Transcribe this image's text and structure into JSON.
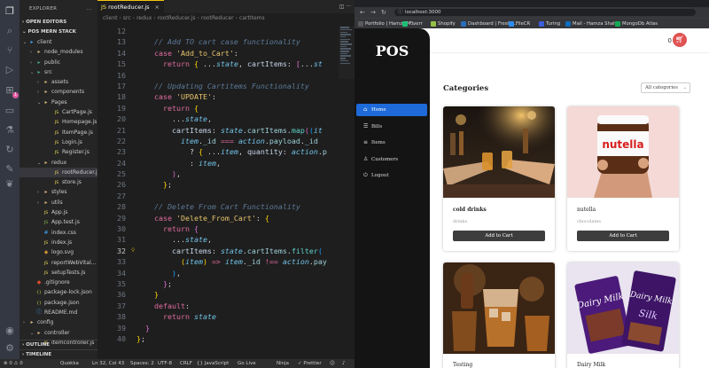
{
  "vscode": {
    "explorer_title": "EXPLORER",
    "explorer_more": "...",
    "open_editors": "OPEN EDITORS",
    "project": "POS MERN STACK",
    "tree": [
      {
        "label": "client",
        "kind": "folder-blue",
        "chev": "⌄"
      },
      {
        "label": "node_modules",
        "kind": "folder",
        "chev": "›"
      },
      {
        "label": "public",
        "kind": "folder-pub",
        "chev": "›"
      },
      {
        "label": "src",
        "kind": "folder-src",
        "chev": "⌄"
      },
      {
        "label": "assets",
        "kind": "folder",
        "chev": "›"
      },
      {
        "label": "components",
        "kind": "folder",
        "chev": "›"
      },
      {
        "label": "Pages",
        "kind": "folder",
        "chev": "⌄"
      },
      {
        "label": "CartPage.js",
        "kind": "js",
        "chev": ""
      },
      {
        "label": "Homepage.js",
        "kind": "js",
        "chev": ""
      },
      {
        "label": "ItemPage.js",
        "kind": "js",
        "chev": ""
      },
      {
        "label": "Login.js",
        "kind": "js",
        "chev": ""
      },
      {
        "label": "Register.js",
        "kind": "js",
        "chev": ""
      },
      {
        "label": "redux",
        "kind": "folder",
        "chev": "⌄"
      },
      {
        "label": "rootReducer.js",
        "kind": "js",
        "chev": "",
        "selected": true
      },
      {
        "label": "store.js",
        "kind": "js",
        "chev": ""
      },
      {
        "label": "styles",
        "kind": "folder",
        "chev": "›"
      },
      {
        "label": "utils",
        "kind": "folder",
        "chev": "›"
      },
      {
        "label": "App.js",
        "kind": "js",
        "chev": ""
      },
      {
        "label": "App.test.js",
        "kind": "test",
        "chev": ""
      },
      {
        "label": "index.css",
        "kind": "css",
        "chev": ""
      },
      {
        "label": "index.js",
        "kind": "js",
        "chev": ""
      },
      {
        "label": "logo.svg",
        "kind": "svg",
        "chev": ""
      },
      {
        "label": "reportWebVital...",
        "kind": "js",
        "chev": ""
      },
      {
        "label": "setupTests.js",
        "kind": "js",
        "chev": ""
      },
      {
        "label": ".gitignore",
        "kind": "git",
        "chev": ""
      },
      {
        "label": "package-lock.json",
        "kind": "json",
        "chev": ""
      },
      {
        "label": "package.json",
        "kind": "json",
        "chev": ""
      },
      {
        "label": "README.md",
        "kind": "md",
        "chev": ""
      },
      {
        "label": "config",
        "kind": "folder",
        "chev": "›"
      },
      {
        "label": "controller",
        "kind": "folder",
        "chev": "⌄"
      },
      {
        "label": "itemcontroller.js",
        "kind": "js",
        "chev": ""
      }
    ],
    "outline": "OUTLINE",
    "timeline": "TIMELINE",
    "tab_label": "rootReducer.js",
    "breadcrumb": [
      "client",
      "src",
      "redux",
      "rootReducer.js",
      "rootReducer",
      "cartItems"
    ],
    "code_lines": [
      {
        "n": "12",
        "html": ""
      },
      {
        "n": "13",
        "html": "    <span class='c'>// Add TO cart case functionality</span>"
      },
      {
        "n": "14",
        "html": "    <span class='k'>case</span> <span class='s'>'Add_to_Cart'</span><span class='p'>:</span>"
      },
      {
        "n": "15",
        "html": "      <span class='k'>return</span> <span class='br1'>{</span> <span class='p'>...</span><span class='it'>state</span><span class='p'>,</span> <span class='v'>cartItems</span><span class='p'>:</span> <span class='br2'>[</span><span class='p'>...</span><span class='it'>st</span>"
      },
      {
        "n": "16",
        "html": ""
      },
      {
        "n": "17",
        "html": "    <span class='c'>// Updating Cartitems Functionality</span>"
      },
      {
        "n": "18",
        "html": "    <span class='k'>case</span> <span class='s'>'UPDATE'</span><span class='p'>:</span>"
      },
      {
        "n": "19",
        "html": "      <span class='k'>return</span> <span class='br1'>{</span>"
      },
      {
        "n": "20",
        "html": "        <span class='p'>...</span><span class='it'>state</span><span class='p'>,</span>"
      },
      {
        "n": "21",
        "html": "        <span class='v'>cartItems</span><span class='p'>:</span> <span class='it'>state</span><span class='p'>.</span><span class='pr'>cartItems</span><span class='p'>.</span><span class='f'>map</span><span class='br2'>(</span><span class='br3'>(</span><span class='it'>it</span>"
      },
      {
        "n": "22",
        "html": "          <span class='it'>item</span><span class='p'>.</span><span class='pr'>_id</span> <span class='op'>===</span> <span class='it'>action</span><span class='p'>.</span><span class='pr'>payload</span><span class='p'>.</span><span class='pr'>_id</span>"
      },
      {
        "n": "23",
        "html": "            <span class='p'>?</span> <span class='br1'>{</span> <span class='p'>...</span><span class='it'>item</span><span class='p'>,</span> <span class='v'>quantity</span><span class='p'>:</span> <span class='it'>action</span><span class='p'>.</span><span class='pr'>p</span>"
      },
      {
        "n": "24",
        "html": "            <span class='p'>:</span> <span class='it'>item</span><span class='p'>,</span>"
      },
      {
        "n": "25",
        "html": "        <span class='br2'>)</span><span class='p'>,</span>"
      },
      {
        "n": "26",
        "html": "      <span class='br1'>}</span><span class='p'>;</span>"
      },
      {
        "n": "27",
        "html": ""
      },
      {
        "n": "28",
        "html": "    <span class='c'>// Delete From Cart Functionality</span>"
      },
      {
        "n": "29",
        "html": "    <span class='k'>case</span> <span class='s'>'Delete_From_Cart'</span><span class='p'>:</span> <span class='br1'>{</span>"
      },
      {
        "n": "30",
        "html": "      <span class='k'>return</span> <span class='br2'>{</span>"
      },
      {
        "n": "31",
        "html": "        <span class='p'>...</span><span class='it'>state</span><span class='p'>,</span>"
      },
      {
        "n": "32",
        "html": "        <span class='v'>cartItems</span><span class='p'>:</span> <span class='it'>state</span><span class='p'>.</span><span class='pr'>cartItems</span><span class='p'>.</span><span class='f'>filter</span><span class='br3'>(</span>",
        "current": true
      },
      {
        "n": "33",
        "html": "          <span class='br1'>(</span><span class='it'>item</span><span class='br1'>)</span> <span class='op'>=&gt;</span> <span class='it'>item</span><span class='p'>.</span><span class='pr'>_id</span> <span class='op'>!==</span> <span class='it'>action</span><span class='p'>.</span><span class='pr'>pay</span>"
      },
      {
        "n": "34",
        "html": "        <span class='br3'>)</span><span class='p'>,</span>"
      },
      {
        "n": "35",
        "html": "      <span class='br2'>}</span><span class='p'>;</span>"
      },
      {
        "n": "36",
        "html": "    <span class='br1'>}</span>"
      },
      {
        "n": "37",
        "html": "    <span class='k'>default</span><span class='p'>:</span>"
      },
      {
        "n": "38",
        "html": "      <span class='k'>return</span> <span class='it'>state</span>"
      },
      {
        "n": "39",
        "html": "  <span class='br2'>}</span>"
      },
      {
        "n": "40",
        "html": "<span class='br1'>}</span><span class='p'>;</span>"
      }
    ],
    "status": {
      "errors": "⊗ 0 ⚠ 0",
      "quokka": "Quokka",
      "position": "Ln 32, Col 43",
      "spaces": "Spaces: 2",
      "encoding": "UTF-8",
      "eol": "CRLF",
      "language": "{} JavaScript",
      "golive": "Go Live",
      "ninja": "Ninja",
      "prettier": "✓ Prettier"
    }
  },
  "browser": {
    "url": "localhost:3000",
    "bookmarks": [
      {
        "label": "Portfolio | Hamza M...",
        "color": "#5a5a5a"
      },
      {
        "label": "Fiverr",
        "color": "#1dbf73"
      },
      {
        "label": "Shopify",
        "color": "#95bf47"
      },
      {
        "label": "Dashboard | Freela...",
        "color": "#2a6ebb"
      },
      {
        "label": "FileCR",
        "color": "#2d8cf0"
      },
      {
        "label": "Turing",
        "color": "#3b5bdb"
      },
      {
        "label": "Mail - Hamza Shah...",
        "color": "#0f6cbd"
      },
      {
        "label": "MongoDb Atlas",
        "color": "#13aa52"
      }
    ]
  },
  "app": {
    "logo": "POS",
    "nav": [
      {
        "label": "Home",
        "icon": "home-icon",
        "glyph": "⌂",
        "active": true
      },
      {
        "label": "Bills",
        "icon": "bills-icon",
        "glyph": "☰"
      },
      {
        "label": "Items",
        "icon": "items-icon",
        "glyph": "≡"
      },
      {
        "label": "Customers",
        "icon": "user-icon",
        "glyph": "♙"
      },
      {
        "label": "Logout",
        "icon": "logout-icon",
        "glyph": "⏻"
      }
    ],
    "cart_count": "0",
    "categories_title": "Categories",
    "category_filter": "All categories",
    "products": [
      {
        "name": "cold drinks",
        "category": "drinks",
        "button": "Add to Cart"
      },
      {
        "name": "nutella",
        "category": "chocolates",
        "button": "Add to Cart"
      },
      {
        "name": "Testing",
        "category": "",
        "button": ""
      },
      {
        "name": "Dairy Milk",
        "category": "",
        "button": ""
      }
    ],
    "nutella_label": "nutella",
    "dairy_label": "Dairy Milk",
    "silk_label": "Silk"
  },
  "colors": {
    "accent": "#1d6ad8",
    "cart": "#e05353",
    "sidebar": "#141414",
    "button": "#3d3d3d"
  }
}
